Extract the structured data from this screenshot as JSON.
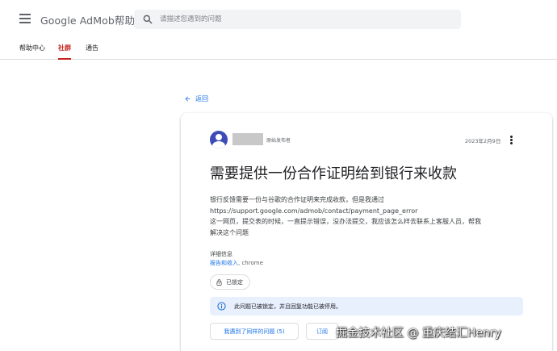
{
  "header": {
    "brand": "Google AdMob帮助",
    "search_placeholder": "请描述您遇到的问题",
    "icons": {
      "menu": "hamburger-menu-icon",
      "search": "search-icon"
    }
  },
  "tabs": [
    {
      "label": "帮助中心",
      "active": false
    },
    {
      "label": "社群",
      "active": true
    },
    {
      "label": "通告",
      "active": false
    }
  ],
  "back_label": "返回",
  "post": {
    "role": "原始发布者",
    "date": "2023年2月9日",
    "title": "需要提供一份合作证明给到银行来收款",
    "body_lines": [
      "银行反馈需要一份与谷歌的合作证明来完成收款，但是我通过",
      "https://support.google.com/admob/contact/payment_page_error",
      "这一网页，提交表的时候，一直提示错误，没办法提交，我应该怎么样去联系上客服人员，帮我",
      "解决这个问题"
    ],
    "details_label": "详细信息",
    "details_link": "报告和收入",
    "details_extra": "chrome",
    "locked_label": "已锁定",
    "notice": "此问题已被锁定，并且回复功能已被停用。",
    "same_question_button": "我遇到了同样的问题 (5)",
    "subscribe_button": "订阅"
  },
  "watermark": "掘金技术社区 @ 重庆结汇Henry",
  "colors": {
    "accent": "#1a73e8",
    "active_tab": "#c5221f",
    "avatar": "#3c4bb8",
    "notice_bg": "#e8f0fe"
  }
}
